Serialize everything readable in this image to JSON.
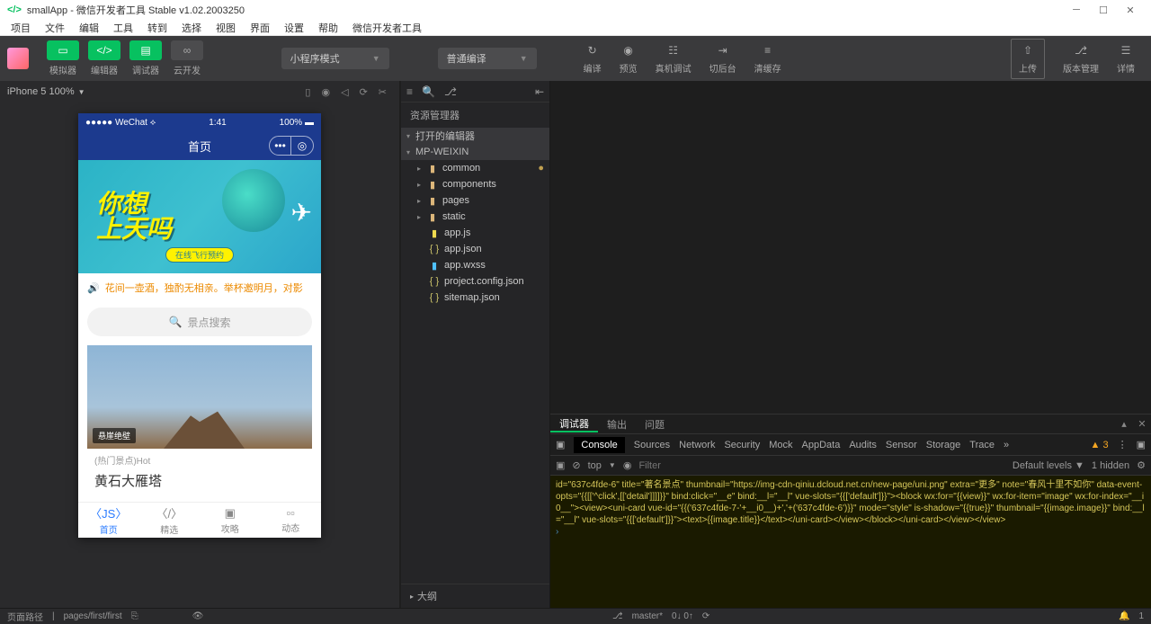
{
  "title": "smallApp - 微信开发者工具 Stable v1.02.2003250",
  "menubar": [
    "项目",
    "文件",
    "编辑",
    "工具",
    "转到",
    "选择",
    "视图",
    "界面",
    "设置",
    "帮助",
    "微信开发者工具"
  ],
  "toolbar": {
    "btns": [
      {
        "label": "模拟器",
        "icon": "📱"
      },
      {
        "label": "编辑器",
        "icon": "< >"
      },
      {
        "label": "调试器",
        "icon": "▥"
      },
      {
        "label": "云开发",
        "icon": "∞"
      }
    ],
    "mode": "小程序模式",
    "compile": "普通编译",
    "actions": [
      {
        "label": "编译",
        "icon": "↻"
      },
      {
        "label": "预览",
        "icon": "◉"
      },
      {
        "label": "真机调试",
        "icon": "☷"
      },
      {
        "label": "切后台",
        "icon": "⇥"
      },
      {
        "label": "清缓存",
        "icon": "≡"
      }
    ],
    "right": [
      {
        "label": "上传",
        "icon": "⇧"
      },
      {
        "label": "版本管理",
        "icon": "⎇"
      },
      {
        "label": "详情",
        "icon": "☰"
      }
    ]
  },
  "sim": {
    "device": "iPhone 5 100%"
  },
  "phone": {
    "carrier": "●●●●● WeChat ⟡",
    "time": "1:41",
    "battery": "100%",
    "pageTitle": "首页",
    "bannerBig": "你想\n上天吗",
    "bannerSub": "在线飞行预约",
    "notice": "花间一壶酒，独酌无相亲。举杯邀明月，对影",
    "searchPlaceholder": "景点搜索",
    "cardTag": "悬崖绝壁",
    "cardMeta": "(热门景点)Hot",
    "cardTitle": "黄石大雁塔",
    "tabs": [
      {
        "icon": "〈JS〉",
        "label": "首页"
      },
      {
        "icon": "〈/〉",
        "label": "精选"
      },
      {
        "icon": "▣",
        "label": "攻略"
      },
      {
        "icon": "▫▫",
        "label": "动态"
      }
    ]
  },
  "explorer": {
    "title": "资源管理器",
    "openEditors": "打开的编辑器",
    "project": "MP-WEIXIN",
    "tree": [
      {
        "type": "folder",
        "name": "common",
        "indent": 1
      },
      {
        "type": "folder",
        "name": "components",
        "indent": 1
      },
      {
        "type": "folder",
        "name": "pages",
        "indent": 1
      },
      {
        "type": "folder",
        "name": "static",
        "indent": 1
      },
      {
        "type": "js",
        "name": "app.js",
        "indent": 1
      },
      {
        "type": "json",
        "name": "app.json",
        "indent": 1
      },
      {
        "type": "wxss",
        "name": "app.wxss",
        "indent": 1
      },
      {
        "type": "json",
        "name": "project.config.json",
        "indent": 1
      },
      {
        "type": "json",
        "name": "sitemap.json",
        "indent": 1
      }
    ],
    "outline": "大纲"
  },
  "devtools": {
    "tabs1": [
      "调试器",
      "输出",
      "问题"
    ],
    "tabs2": [
      "Console",
      "Sources",
      "Network",
      "Security",
      "Mock",
      "AppData",
      "Audits",
      "Sensor",
      "Storage",
      "Trace"
    ],
    "warnCount": "3",
    "ctx": "top",
    "filterPlaceholder": "Filter",
    "levels": "Default levels",
    "hidden": "1 hidden",
    "console": "id=\"637c4fde-6\" title=\"著名景点\" thumbnail=\"https://img-cdn-qiniu.dcloud.net.cn/new-page/uni.png\" extra=\"更多\" note=\"春风十里不如你\" data-event-opts=\"{{[['^click',[['detail']]]]}}\" bind:click=\"__e\" bind:__l=\"__l\" vue-slots=\"{{['default']}}\"><block wx:for=\"{{view}}\" wx:for-item=\"image\" wx:for-index=\"__i0__\"><view><uni-card vue-id=\"{{('637c4fde-7-'+__i0__)+','+('637c4fde-6')}}\" mode=\"style\" is-shadow=\"{{true}}\" thumbnail=\"{{image.image}}\" bind:__l=\"__l\" vue-slots=\"{{['default']}}\"><text>{{image.title}}</text></uni-card></view></block></uni-card></view></view>"
  },
  "status": {
    "pathLabel": "页面路径",
    "path": "pages/first/first",
    "branch": "master*",
    "changes": "0↓ 0↑",
    "notificationCount": "1"
  }
}
